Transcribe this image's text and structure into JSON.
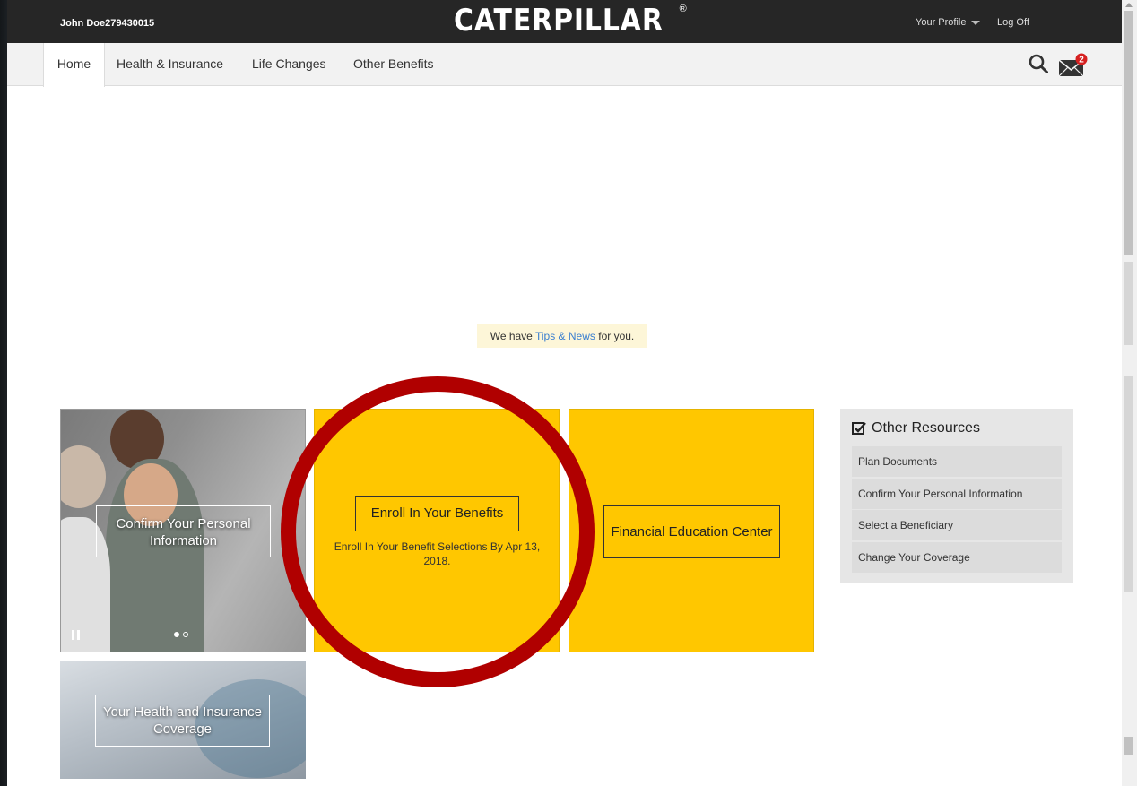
{
  "header": {
    "user_name": "John Doe279430015",
    "logo_text": "CATERPILLAR",
    "logo_mark": "®",
    "profile_label": "Your Profile",
    "logoff_label": "Log Off"
  },
  "nav": {
    "tabs": [
      {
        "label": "Home",
        "active": true
      },
      {
        "label": "Health & Insurance",
        "active": false
      },
      {
        "label": "Life Changes",
        "active": false
      },
      {
        "label": "Other Benefits",
        "active": false
      }
    ],
    "icons": {
      "search": "search-icon",
      "mail": "mail-icon"
    },
    "mail_badge": "2"
  },
  "tips": {
    "prefix": "We have",
    "link": "Tips & News",
    "suffix": "for you."
  },
  "tiles": {
    "personal_info": "Confirm Your Personal Information",
    "enroll_button": "Enroll In Your Benefits",
    "enroll_subtext": "Enroll In Your Benefit Selections By Apr 13, 2018.",
    "financial": "Financial Education Center",
    "health": "Your Health and Insurance Coverage"
  },
  "carousel": {
    "slides": 2,
    "active_slide": 1
  },
  "resources": {
    "title": "Other Resources",
    "items": [
      "Plan Documents",
      "Confirm Your Personal Information",
      "Select a Beneficiary",
      "Change Your Coverage"
    ]
  },
  "colors": {
    "accent_yellow": "#ffc700",
    "topbar": "#262626",
    "annotation_circle": "#b00000",
    "link": "#3a7fd0",
    "badge": "#d62020"
  }
}
